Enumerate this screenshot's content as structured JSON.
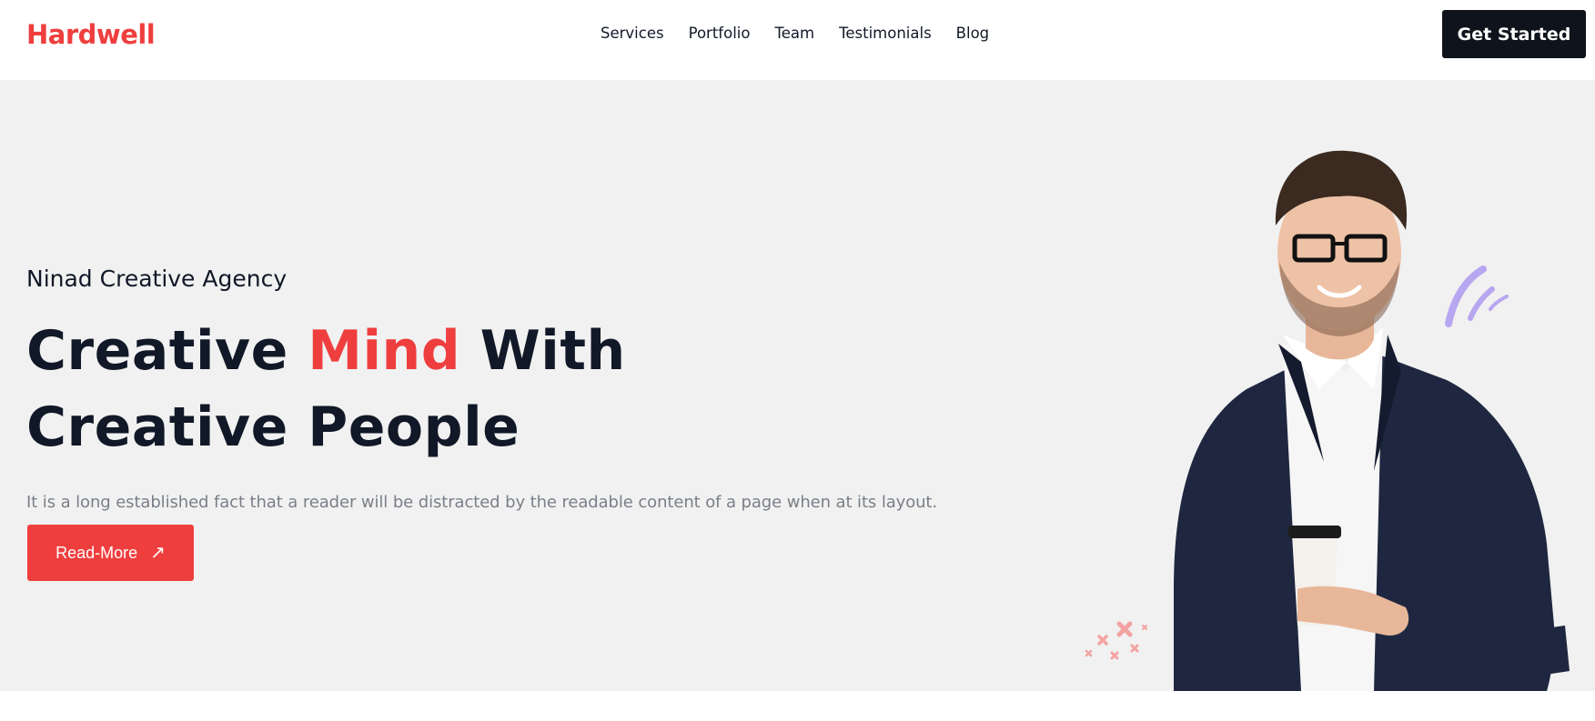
{
  "header": {
    "logo": "Hardwell",
    "nav": [
      "Services",
      "Portfolio",
      "Team",
      "Testimonials",
      "Blog"
    ],
    "cta_label": "Get Started"
  },
  "hero": {
    "eyebrow": "Ninad Creative Agency",
    "title_part1": "Creative ",
    "title_accent": "Mind",
    "title_part2": " With Creative People",
    "description": "It is a long established fact that a reader will be distracted by the readable content of a page when at its layout.",
    "button_label": "Read-More",
    "button_icon": "arrow-up-right-icon"
  },
  "colors": {
    "brand": "#ef3e3e",
    "dark": "#0f141c",
    "hero_bg": "#f1f1f1",
    "muted_text": "#7a7f88",
    "deco_purple": "#b7a6f0",
    "deco_pink": "#f4a3a3"
  }
}
